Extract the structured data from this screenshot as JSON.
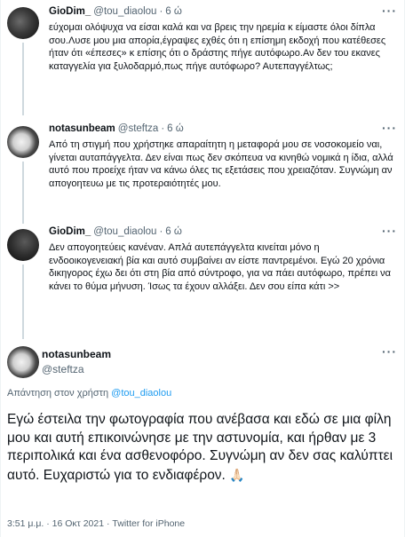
{
  "tweets": [
    {
      "name": "GioDim_",
      "handle": "@tou_diaolou",
      "time": "6 ώ",
      "text": "εύχομαι ολόψυχα να είσαι καλά και να βρεις την ηρεμία κ είμαστε όλοι δίπλα σου.Λυσε μου μια απορία,έγραψες εχθές ότι η επίσημη εκδοχή που κατέθεσες ήταν ότι «έπεσες» κ επίσης ότι ο δράστης πήγε αυτόφωρο.Αν δεν του εκανες καταγγελία για ξυλοδαρμό,πως πήγε αυτόφωρο? Αυτεπαγγέλτως;"
    },
    {
      "name": "notasunbeam",
      "handle": "@steftza",
      "time": "6 ώ",
      "text": "Από τη στιγμή που χρήστηκε απαραίτητη η μεταφορά μου σε νοσοκομείο ναι, γίνεται αυταπάγγελτα. Δεν είναι πως δεν σκόπευα να κινηθώ νομικά η ίδια, αλλά αυτό που προείχε ήταν να κάνω όλες τις εξετάσεις που χρειαζόταν. Συγνώμη αν απογοητευω με τις προτεραιότητές μου."
    },
    {
      "name": "GioDim_",
      "handle": "@tou_diaolou",
      "time": "6 ώ",
      "text": "Δεν απογοητεύεις κανέναν. Απλά αυτεπάγγελτα κινείται μόνο η ενδοοικογενειακή βία και αυτό συμβαίνει αν είστε παντρεμένοι. Εγώ 20 χρόνια δικηγορος έχω δει ότι στη βία από σύντροφο, για να πάει αυτόφωρο, πρέπει να κάνει το θύμα μήνυση. Ίσως τα έχουν αλλάξει. Δεν σου είπα κάτι >>"
    }
  ],
  "main_tweet": {
    "name": "notasunbeam",
    "handle": "@steftza",
    "reply_prefix": "Απάντηση στον χρήστη",
    "reply_handle": "@tou_diaolou",
    "text": "Εγώ έστειλα την φωτογραφία που ανέβασα και εδώ σε μια φίλη μου και αυτή επικοινώνησε με την αστυνομία, και ήρθαν με 3 περιπολικά και ένα ασθενοφόρο. Συγνώμη αν δεν σας καλύπτει αυτό. Ευχαριστώ για το ενδιαφέρον.",
    "emoji": "🙏🏻",
    "timestamp": "3:51 μ.μ. · 16 Οκτ 2021",
    "separator": " · ",
    "source": "Twitter for iPhone"
  },
  "more_glyph": "···",
  "dot": "·"
}
